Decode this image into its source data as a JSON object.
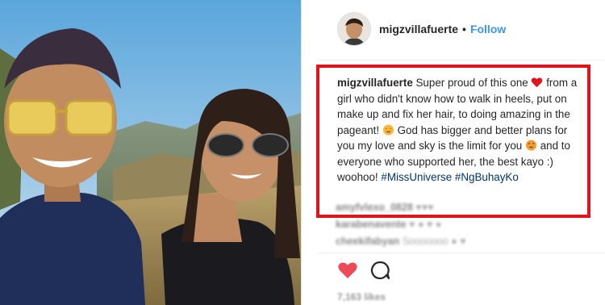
{
  "post": {
    "username": "migzvillafuerte",
    "separator": "•",
    "follow_label": "Follow",
    "caption": {
      "username": "migzvillafuerte",
      "part1": "Super proud of this one",
      "part2": "from a girl who didn't know how to walk in heels, put on make up and fix her hair, to doing amazing in the pageant!",
      "part3": "God has bigger and better plans for you my love and sky is the limit for you",
      "part4": "and to everyone who supported her, the best kayo :) woohoo!",
      "hashtags": "#MissUniverse #NgBuhayKo"
    },
    "comments": [
      {
        "user": "amyfvlexo_0828",
        "text": "♥♥♥"
      },
      {
        "user": "karabenavente",
        "text": "♥ ● ♥ ●"
      },
      {
        "user": "cheekifabyan",
        "text": "Sooooooo ● ♥"
      }
    ],
    "likes": "7,163 likes"
  },
  "icons": {
    "heart": "heart-icon",
    "comment": "comment-icon",
    "emoji_heart": "red-heart-emoji",
    "emoji_star_face": "star-struck-emoji",
    "emoji_heart_eyes": "heart-eyes-emoji"
  },
  "colors": {
    "follow": "#3897f0",
    "highlight_border": "#e0141a",
    "like_heart": "#ed4956",
    "text": "#262626"
  }
}
